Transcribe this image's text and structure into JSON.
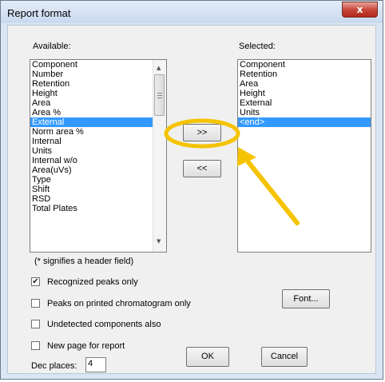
{
  "window": {
    "title": "Report format",
    "close_glyph": "x"
  },
  "available": {
    "label": "Available:",
    "items": [
      "Component",
      "Number",
      "Retention",
      "Height",
      "Area",
      "Area %",
      "External",
      "Norm area %",
      "Internal",
      "Units",
      "Internal w/o",
      "Area(uVs)",
      "Type",
      "Shift",
      "RSD",
      "Total Plates"
    ],
    "selected_item": "External",
    "note": "(* signifies a header field)"
  },
  "selected": {
    "label": "Selected:",
    "items": [
      "Component",
      "Retention",
      "Area",
      "Height",
      "External",
      "Units",
      "<end>"
    ],
    "selected_item": "<end>"
  },
  "buttons": {
    "add": ">>",
    "remove": "<<",
    "font": "Font...",
    "ok": "OK",
    "cancel": "Cancel"
  },
  "options": [
    {
      "label": "Recognized peaks only",
      "checked": true
    },
    {
      "label": "Peaks on printed chromatogram only",
      "checked": false
    },
    {
      "label": "Undetected components also",
      "checked": false
    },
    {
      "label": "New page for report",
      "checked": false
    }
  ],
  "dec_places": {
    "label": "Dec places:",
    "value": "4"
  },
  "annotation": {
    "color": "#f5c300"
  }
}
